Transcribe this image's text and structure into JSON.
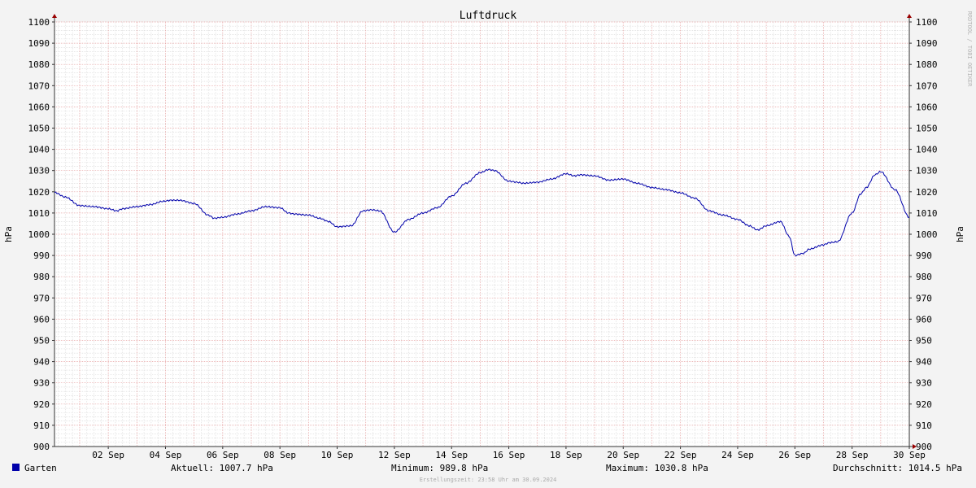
{
  "chart_data": {
    "type": "line",
    "title": "Luftdruck",
    "ylabel": "hPa",
    "ylabel_right": "hPa",
    "watermark": "RRDTOOL / TOBI OETIKER",
    "ylim": [
      900,
      1100
    ],
    "yticks": [
      900,
      910,
      920,
      930,
      940,
      950,
      960,
      970,
      980,
      990,
      1000,
      1010,
      1020,
      1030,
      1040,
      1050,
      1060,
      1070,
      1080,
      1090,
      1100
    ],
    "xrange_days": [
      0.12,
      30.0
    ],
    "xticks": [
      {
        "day": 2,
        "label": "02 Sep"
      },
      {
        "day": 4,
        "label": "04 Sep"
      },
      {
        "day": 6,
        "label": "06 Sep"
      },
      {
        "day": 8,
        "label": "08 Sep"
      },
      {
        "day": 10,
        "label": "10 Sep"
      },
      {
        "day": 12,
        "label": "12 Sep"
      },
      {
        "day": 14,
        "label": "14 Sep"
      },
      {
        "day": 16,
        "label": "16 Sep"
      },
      {
        "day": 18,
        "label": "18 Sep"
      },
      {
        "day": 20,
        "label": "20 Sep"
      },
      {
        "day": 22,
        "label": "22 Sep"
      },
      {
        "day": 24,
        "label": "24 Sep"
      },
      {
        "day": 26,
        "label": "26 Sep"
      },
      {
        "day": 28,
        "label": "28 Sep"
      },
      {
        "day": 30,
        "label": "30 Sep"
      }
    ],
    "series": [
      {
        "name": "Garten",
        "color": "#0000aa",
        "x": [
          0.12,
          0.5,
          1.0,
          1.5,
          2.0,
          2.3,
          2.5,
          3.0,
          3.5,
          3.9,
          4.2,
          4.5,
          5.0,
          5.5,
          5.7,
          6.0,
          6.5,
          7.0,
          7.5,
          8.0,
          8.3,
          8.5,
          9.0,
          9.4,
          9.7,
          10.0,
          10.5,
          10.9,
          11.2,
          11.5,
          12.0,
          12.5,
          13.0,
          13.5,
          14.0,
          14.5,
          15.0,
          15.3,
          15.5,
          16.0,
          16.3,
          16.5,
          17.0,
          17.5,
          18.0,
          18.3,
          18.5,
          19.0,
          19.5,
          20.0,
          20.5,
          21.0,
          21.5,
          22.0,
          22.5,
          23.0,
          23.5,
          24.0,
          24.4,
          24.7,
          25.0,
          25.5,
          25.8,
          26.0,
          26.3,
          26.5,
          27.0,
          27.2,
          27.5,
          28.0,
          28.3,
          28.5,
          28.8,
          29.0,
          29.5,
          30.0
        ],
        "values": [
          1019.7,
          1017.5,
          1013.5,
          1013.0,
          1012.0,
          1011.0,
          1012.0,
          1013.0,
          1014.0,
          1015.5,
          1016.0,
          1016.0,
          1014.5,
          1009.0,
          1007.5,
          1008.0,
          1009.5,
          1011.0,
          1013.0,
          1012.5,
          1010.0,
          1009.5,
          1009.0,
          1007.5,
          1006.0,
          1003.5,
          1004.0,
          1011.0,
          1011.5,
          1011.0,
          1001.0,
          1007.0,
          1010.0,
          1012.5,
          1018.0,
          1024.0,
          1029.0,
          1030.5,
          1030.0,
          1025.0,
          1024.5,
          1024.0,
          1024.5,
          1026.0,
          1028.5,
          1027.5,
          1028.0,
          1027.5,
          1025.5,
          1026.0,
          1024.0,
          1022.0,
          1021.0,
          1019.5,
          1017.0,
          1011.0,
          1009.0,
          1007.0,
          1004.0,
          1002.0,
          1004.0,
          1006.0,
          999.0,
          990.0,
          991.0,
          993.0,
          995.0,
          996.0,
          996.5,
          1010.0,
          1019.0,
          1022.0,
          1028.0,
          1029.5,
          1021.0,
          1008.0
        ]
      }
    ],
    "legend": {
      "series_name": "Garten",
      "color": "#0000aa",
      "current": "Aktuell: 1007.7 hPa",
      "minimum": "Minimum: 989.8 hPa",
      "maximum": "Maximum: 1030.8 hPa",
      "average": "Durchschnitt: 1014.5 hPa"
    },
    "footer": "Erstellungszeit: 23:58 Uhr am 30.09.2024",
    "colors": {
      "background": "#f3f3f3",
      "plot_background": "#ffffff",
      "major_grid": "#e6a3a3",
      "minor_grid": "#d8d8d8",
      "axis": "#333333",
      "arrow": "#990000"
    }
  }
}
